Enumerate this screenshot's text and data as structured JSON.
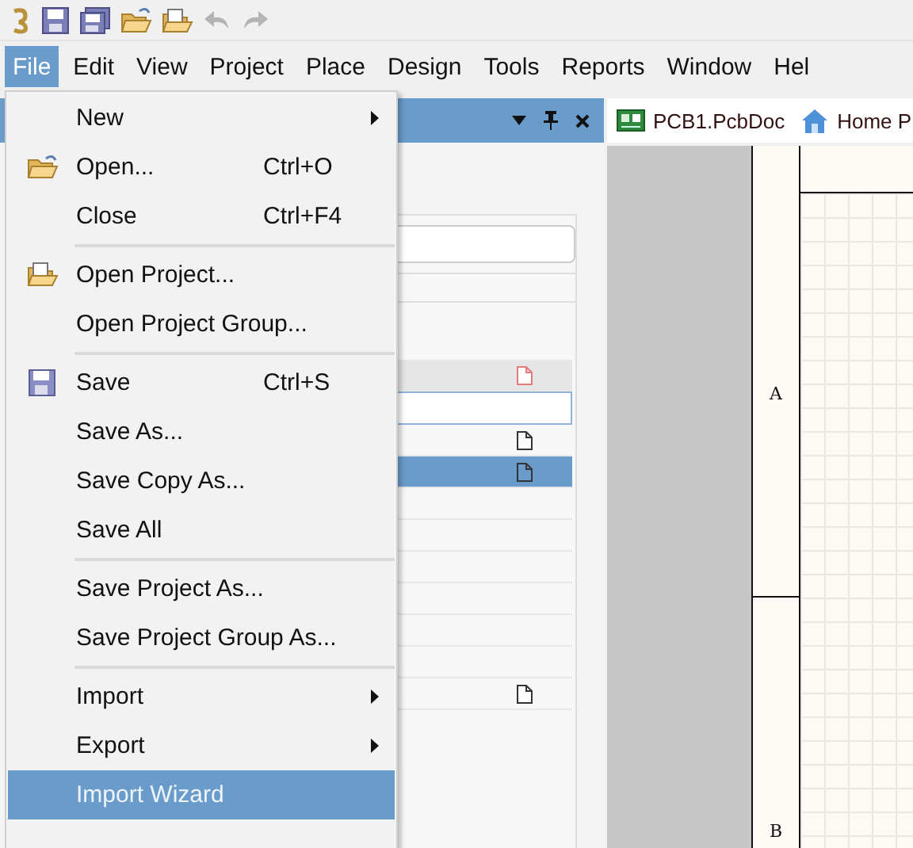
{
  "menubar": [
    {
      "label": "File",
      "selected": true
    },
    {
      "label": "Edit",
      "selected": false
    },
    {
      "label": "View",
      "selected": false
    },
    {
      "label": "Project",
      "selected": false
    },
    {
      "label": "Place",
      "selected": false
    },
    {
      "label": "Design",
      "selected": false
    },
    {
      "label": "Tools",
      "selected": false
    },
    {
      "label": "Reports",
      "selected": false
    },
    {
      "label": "Window",
      "selected": false
    },
    {
      "label": "Hel",
      "selected": false
    }
  ],
  "file_menu": [
    {
      "kind": "submenu",
      "label": "New",
      "selected": false
    },
    {
      "kind": "item",
      "label": "Open...",
      "shortcut": "Ctrl+O",
      "selected": false
    },
    {
      "kind": "item",
      "label": "Close",
      "shortcut": "Ctrl+F4",
      "selected": false
    },
    {
      "kind": "separator"
    },
    {
      "kind": "item",
      "label": "Open Project...",
      "selected": false
    },
    {
      "kind": "item",
      "label": "Open Project Group...",
      "selected": false
    },
    {
      "kind": "separator"
    },
    {
      "kind": "item",
      "label": "Save",
      "shortcut": "Ctrl+S",
      "selected": false
    },
    {
      "kind": "item",
      "label": "Save As...",
      "selected": false
    },
    {
      "kind": "item",
      "label": "Save Copy As...",
      "selected": false
    },
    {
      "kind": "item",
      "label": "Save All",
      "selected": false
    },
    {
      "kind": "separator"
    },
    {
      "kind": "item",
      "label": "Save Project As...",
      "selected": false
    },
    {
      "kind": "item",
      "label": "Save Project Group As...",
      "selected": false
    },
    {
      "kind": "separator"
    },
    {
      "kind": "submenu",
      "label": "Import",
      "selected": false
    },
    {
      "kind": "submenu",
      "label": "Export",
      "selected": false
    },
    {
      "kind": "item",
      "label": "Import Wizard",
      "selected": true
    }
  ],
  "panel": {
    "rows": [
      {
        "kind": "file-warning",
        "selected": false,
        "highlighted": true,
        "focused": false
      },
      {
        "kind": "plain",
        "selected": false,
        "highlighted": false,
        "focused": true
      },
      {
        "kind": "file",
        "selected": false,
        "highlighted": false,
        "focused": false
      },
      {
        "kind": "file",
        "selected": true,
        "highlighted": false,
        "focused": false
      },
      {
        "kind": "plain",
        "selected": false,
        "highlighted": false,
        "focused": false
      },
      {
        "kind": "plain",
        "selected": false,
        "highlighted": false,
        "focused": false
      },
      {
        "kind": "plain",
        "selected": false,
        "highlighted": false,
        "focused": false
      },
      {
        "kind": "plain",
        "selected": false,
        "highlighted": false,
        "focused": false
      },
      {
        "kind": "plain",
        "selected": false,
        "highlighted": false,
        "focused": false
      },
      {
        "kind": "plain",
        "selected": false,
        "highlighted": false,
        "focused": false
      },
      {
        "kind": "file",
        "selected": false,
        "highlighted": false,
        "focused": false
      }
    ]
  },
  "document_tabs": [
    {
      "kind": "pcb",
      "label": "PCB1.PcbDoc"
    },
    {
      "kind": "home",
      "label": "Home P"
    }
  ],
  "sheet": {
    "zones": [
      "A",
      "B"
    ]
  }
}
